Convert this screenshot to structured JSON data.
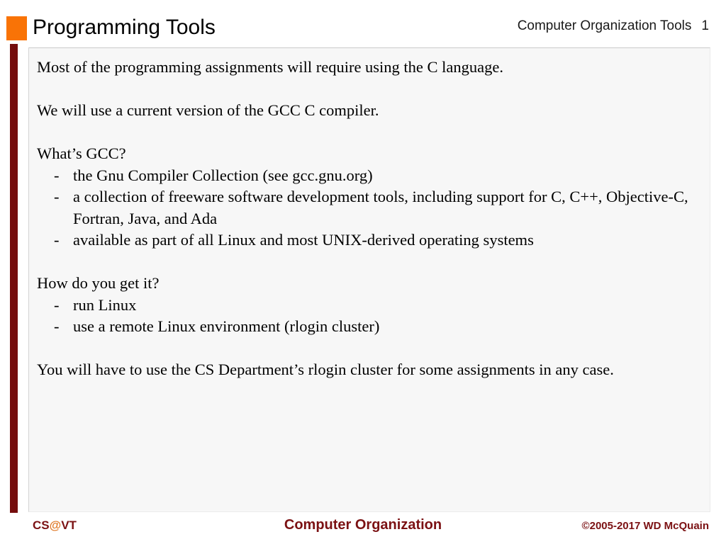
{
  "header": {
    "title": "Programming Tools",
    "right_label": "Computer Organization Tools",
    "slide_number": "1",
    "marker_color": "#f97306"
  },
  "theme": {
    "accent_bar_color": "#750d0d",
    "panel_bg": "#f7f7f7",
    "footer_text_color": "#7b1113",
    "footer_at_color": "#e07b2a"
  },
  "content": {
    "paragraph_1": "Most of the programming assignments will require using the C language.",
    "paragraph_2": "We will use a current version of the GCC C compiler.",
    "heading_gcc": "What’s GCC?",
    "gcc_bullets": [
      {
        "marker": "-",
        "text": "the Gnu Compiler Collection (see gcc.gnu.org)"
      },
      {
        "marker": "-",
        "text": "a collection of freeware software development tools, including support for C, C++, Objective-C, Fortran, Java, and Ada"
      },
      {
        "marker": "-",
        "text": "available as part of all Linux and most UNIX-derived operating systems"
      }
    ],
    "heading_get": "How do you get it?",
    "get_bullets": [
      {
        "marker": "-",
        "text": "run Linux"
      },
      {
        "marker": "-",
        "text": "use a remote Linux environment (rlogin cluster)"
      }
    ],
    "paragraph_3": "You will have to use the CS Department’s rlogin cluster for some assignments in any case."
  },
  "footer": {
    "left_prefix": "CS",
    "left_at": "@",
    "left_suffix": "VT",
    "center": "Computer Organization",
    "right": "©2005-2017 WD McQuain"
  }
}
